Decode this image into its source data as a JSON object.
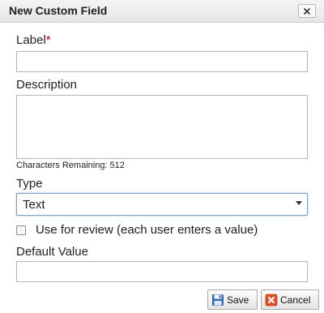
{
  "dialog": {
    "title": "New Custom Field",
    "close_label": "×"
  },
  "form": {
    "label_field": {
      "label": "Label",
      "required_mark": "*",
      "value": ""
    },
    "description_field": {
      "label": "Description",
      "value": ""
    },
    "characters_remaining": "Characters Remaining: 512",
    "type_field": {
      "label": "Type",
      "selected": "Text"
    },
    "review_checkbox": {
      "label": "Use for review (each user enters a value)",
      "checked": false
    },
    "default_value_field": {
      "label": "Default Value",
      "value": ""
    }
  },
  "buttons": {
    "save_label": "Save",
    "cancel_label": "Cancel"
  },
  "icons": {
    "save": "save-icon",
    "cancel": "cancel-icon",
    "close": "close-icon",
    "dropdown": "chevron-down-icon"
  },
  "colors": {
    "required": "#cc0000",
    "cancel_icon": "#e0502a",
    "save_icon": "#2f6bb3"
  }
}
